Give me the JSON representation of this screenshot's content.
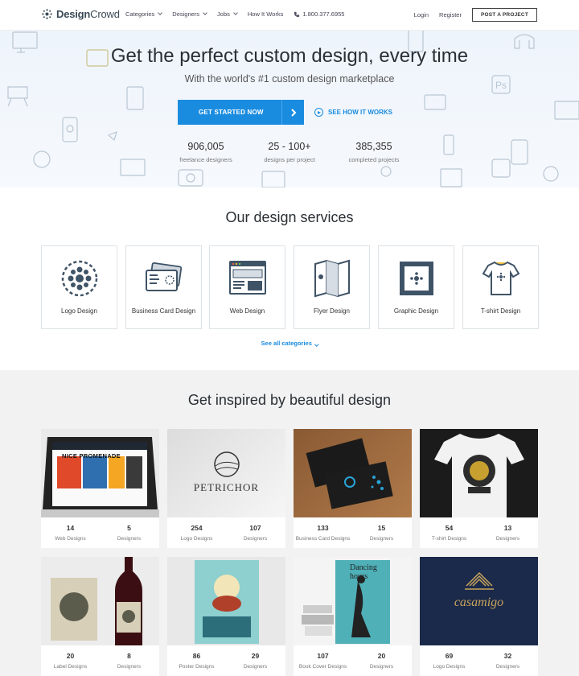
{
  "header": {
    "brand_bold": "Design",
    "brand_regular": "Crowd",
    "menu": [
      {
        "label": "Categories",
        "has_dropdown": true
      },
      {
        "label": "Designers",
        "has_dropdown": true
      },
      {
        "label": "Jobs",
        "has_dropdown": true
      },
      {
        "label": "How It Works",
        "has_dropdown": false
      }
    ],
    "phone": "1.800.377.6955",
    "login": "Login",
    "register": "Register",
    "post_project": "POST A PROJECT"
  },
  "hero": {
    "title": "Get the perfect custom design, every time",
    "subtitle": "With the world's #1 custom design marketplace",
    "cta_label": "GET STARTED NOW",
    "how_label": "SEE HOW IT WORKS",
    "stats": [
      {
        "value": "906,005",
        "label": "freelance designers"
      },
      {
        "value": "25 - 100+",
        "label": "designs per project"
      },
      {
        "value": "385,355",
        "label": "completed projects"
      }
    ]
  },
  "services": {
    "title": "Our design services",
    "items": [
      {
        "label": "Logo Design",
        "icon": "logo-design-icon"
      },
      {
        "label": "Business Card Design",
        "icon": "business-card-icon"
      },
      {
        "label": "Web Design",
        "icon": "web-design-icon"
      },
      {
        "label": "Flyer Design",
        "icon": "flyer-icon"
      },
      {
        "label": "Graphic Design",
        "icon": "graphic-design-icon"
      },
      {
        "label": "T-shirt Design",
        "icon": "tshirt-icon"
      }
    ],
    "see_all": "See all categories"
  },
  "inspired": {
    "title": "Get inspired by beautiful design",
    "cards": [
      {
        "count": "14",
        "count_label": "Web Designs",
        "designers": "5",
        "designers_label": "Designers",
        "image_text": "NICE PROMENADE"
      },
      {
        "count": "254",
        "count_label": "Logo Designs",
        "designers": "107",
        "designers_label": "Designers",
        "image_text": "PETRICHOR"
      },
      {
        "count": "133",
        "count_label": "Business Card Designs",
        "designers": "15",
        "designers_label": "Designers",
        "image_text": ""
      },
      {
        "count": "54",
        "count_label": "T-shirt Designs",
        "designers": "13",
        "designers_label": "Designers",
        "image_text": ""
      },
      {
        "count": "20",
        "count_label": "Label Designs",
        "designers": "8",
        "designers_label": "Designers",
        "image_text": ""
      },
      {
        "count": "86",
        "count_label": "Poster Designs",
        "designers": "29",
        "designers_label": "Designers",
        "image_text": ""
      },
      {
        "count": "107",
        "count_label": "Book Cover Designs",
        "designers": "20",
        "designers_label": "Designers",
        "image_text": "Dancing hours"
      },
      {
        "count": "69",
        "count_label": "Logo Designs",
        "designers": "32",
        "designers_label": "Designers",
        "image_text": "casamigo"
      }
    ]
  },
  "colors": {
    "accent": "#1a8ce0",
    "dark_text": "#2a2f34",
    "gallery_bg": "#f2f2f2"
  }
}
